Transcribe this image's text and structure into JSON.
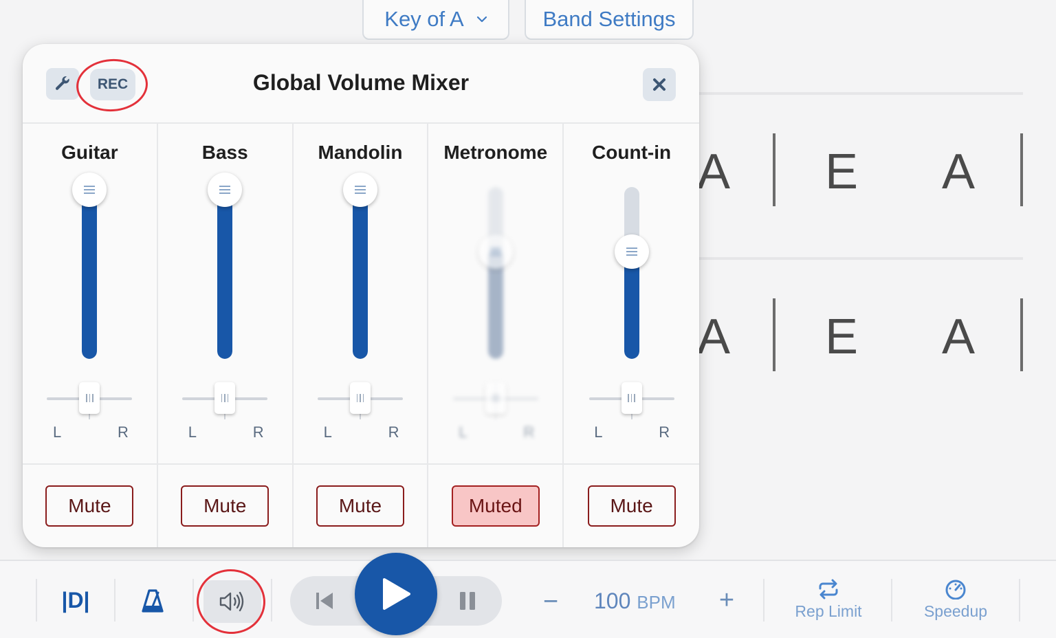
{
  "top_bar": {
    "key_label": "Key of A",
    "band_settings_label": "Band Settings"
  },
  "sheet": {
    "rows": [
      [
        "A",
        "E",
        "A"
      ],
      [
        "A",
        "E",
        "A"
      ]
    ]
  },
  "mixer": {
    "title": "Global Volume Mixer",
    "rec_label": "REC",
    "channels": [
      {
        "name": "Guitar",
        "volume": 1.0,
        "pan": 0.0,
        "mute_label": "Mute",
        "muted": false
      },
      {
        "name": "Bass",
        "volume": 1.0,
        "pan": 0.0,
        "mute_label": "Mute",
        "muted": false
      },
      {
        "name": "Mandolin",
        "volume": 1.0,
        "pan": 0.0,
        "mute_label": "Mute",
        "muted": false
      },
      {
        "name": "Metronome",
        "volume": 0.6,
        "pan": 0.0,
        "mute_label": "Muted",
        "muted": true
      },
      {
        "name": "Count-in",
        "volume": 0.6,
        "pan": 0.0,
        "mute_label": "Mute",
        "muted": false
      }
    ],
    "pan_left_label": "L",
    "pan_right_label": "R"
  },
  "toolbar": {
    "d_label": "|D|",
    "minus_label": "−",
    "tempo_value": "100",
    "tempo_unit": "BPM",
    "plus_label": "+",
    "rep_limit_label": "Rep Limit",
    "speedup_label": "Speedup"
  },
  "colors": {
    "accent": "#1857a8",
    "link": "#3f7bc4",
    "muted_bg": "#f8c6c6",
    "annotation": "#e3313a"
  }
}
